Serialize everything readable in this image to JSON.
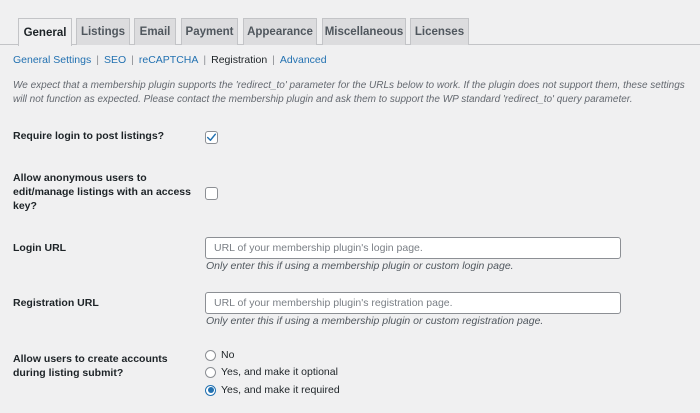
{
  "tabs": [
    {
      "label": "General"
    },
    {
      "label": "Listings"
    },
    {
      "label": "Email"
    },
    {
      "label": "Payment"
    },
    {
      "label": "Appearance"
    },
    {
      "label": "Miscellaneous"
    },
    {
      "label": "Licenses"
    }
  ],
  "subnav": {
    "general_settings": "General Settings",
    "seo": "SEO",
    "recaptcha": "reCAPTCHA",
    "registration": "Registration",
    "advanced": "Advanced",
    "separator": "|"
  },
  "description": "We expect that a membership plugin supports the 'redirect_to' parameter for the URLs below to work. If the plugin does not support them, these settings will not function as expected. Please contact the membership plugin and ask them to support the WP standard 'redirect_to' query parameter.",
  "require_login": {
    "label": "Require login to post listings?",
    "checked": true
  },
  "anonymous": {
    "label_line1": "Allow anonymous users to",
    "label_line2": "edit/manage listings with an access",
    "label_line3": "key?",
    "checked": false
  },
  "login_url": {
    "label": "Login URL",
    "value": "",
    "placeholder": "URL of your membership plugin's login page.",
    "hint": "Only enter this if using a membership plugin or custom login page."
  },
  "registration_url": {
    "label": "Registration URL",
    "value": "",
    "placeholder": "URL of your membership plugin's registration page.",
    "hint": "Only enter this if using a membership plugin or custom registration page."
  },
  "create_accounts": {
    "label_line1": "Allow users to create accounts",
    "label_line2": "during listing submit?",
    "options": [
      {
        "label": "No",
        "checked": false
      },
      {
        "label": "Yes, and make it optional",
        "checked": false
      },
      {
        "label": "Yes, and make it required",
        "checked": true
      }
    ]
  },
  "colors": {
    "background": "#f0f0f1",
    "link": "#2271b1",
    "check": "#2271b1"
  }
}
